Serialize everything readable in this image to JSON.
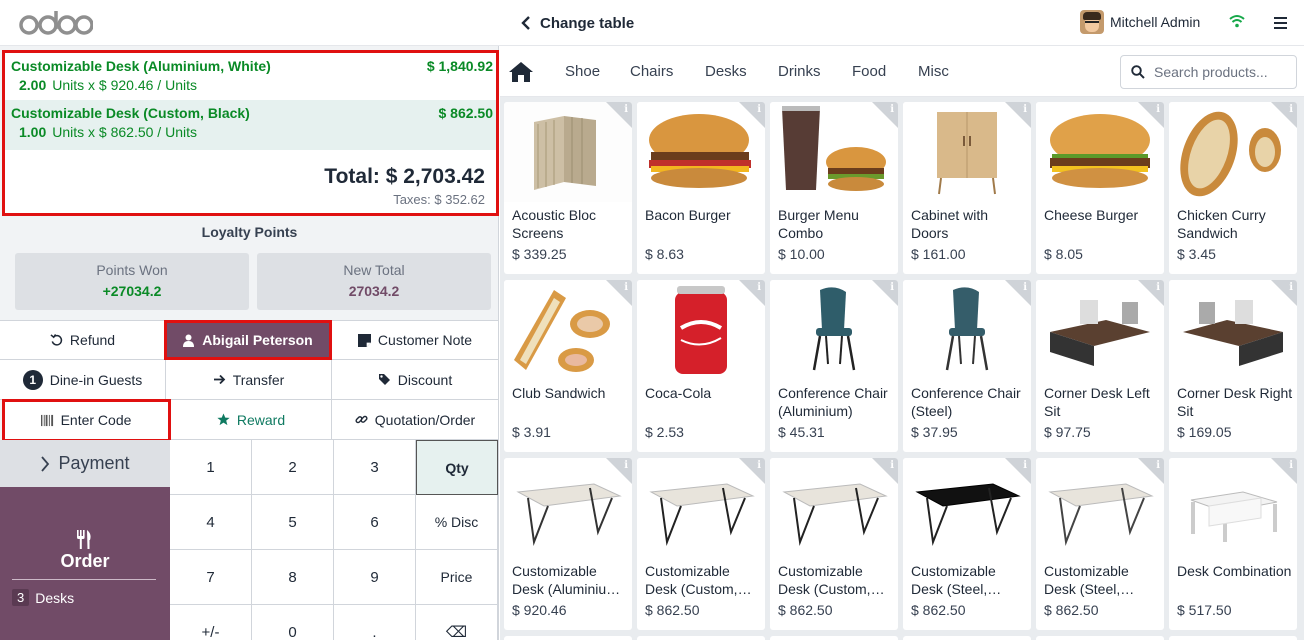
{
  "header": {
    "logo_text": "odoo",
    "back_label": "Change table",
    "user_name": "Mitchell Admin"
  },
  "order": {
    "lines": [
      {
        "name": "Customizable Desk (Aluminium, White)",
        "price": "$ 1,840.92",
        "qty": "2.00",
        "unit_text": "Units x $ 920.46 / Units"
      },
      {
        "name": "Customizable Desk (Custom, Black)",
        "price": "$ 862.50",
        "qty": "1.00",
        "unit_text": "Units x $ 862.50 / Units"
      }
    ],
    "total": "Total: $ 2,703.42",
    "taxes": "Taxes: $ 352.62"
  },
  "loyalty": {
    "title": "Loyalty Points",
    "points_won_label": "Points Won",
    "points_won_value": "+27034.2",
    "new_total_label": "New Total",
    "new_total_value": "27034.2"
  },
  "controls": {
    "refund": "Refund",
    "customer": "Abigail Peterson",
    "customer_note": "Customer Note",
    "guests_count": "1",
    "guests": "Dine-in Guests",
    "transfer": "Transfer",
    "discount": "Discount",
    "enter_code": "Enter Code",
    "reward": "Reward",
    "quotation": "Quotation/Order"
  },
  "payment_label": "Payment",
  "order_button": {
    "label": "Order",
    "count": "3",
    "category": "Desks"
  },
  "keypad": {
    "k1": "1",
    "k2": "2",
    "k3": "3",
    "k4": "4",
    "k5": "5",
    "k6": "6",
    "k7": "7",
    "k8": "8",
    "k9": "9",
    "kpm": "+/-",
    "k0": "0",
    "kdot": ".",
    "qty": "Qty",
    "disc": "% Disc",
    "price": "Price",
    "back": "⌫",
    "active_mode": "Qty"
  },
  "categories": [
    "Shoe",
    "Chairs",
    "Desks",
    "Drinks",
    "Food",
    "Misc"
  ],
  "search": {
    "placeholder": "Search products..."
  },
  "products": [
    {
      "name": "Acoustic Bloc Screens",
      "price": "$ 339.25"
    },
    {
      "name": "Bacon Burger",
      "price": "$ 8.63"
    },
    {
      "name": "Burger Menu Combo",
      "price": "$ 10.00"
    },
    {
      "name": "Cabinet with Doors",
      "price": "$ 161.00"
    },
    {
      "name": "Cheese Burger",
      "price": "$ 8.05"
    },
    {
      "name": "Chicken Curry Sandwich",
      "price": "$ 3.45"
    },
    {
      "name": "Club Sandwich",
      "price": "$ 3.91"
    },
    {
      "name": "Coca-Cola",
      "price": "$ 2.53"
    },
    {
      "name": "Conference Chair (Aluminium)",
      "price": "$ 45.31"
    },
    {
      "name": "Conference Chair (Steel)",
      "price": "$ 37.95"
    },
    {
      "name": "Corner Desk Left Sit",
      "price": "$ 97.75"
    },
    {
      "name": "Corner Desk Right Sit",
      "price": "$ 169.05"
    },
    {
      "name": "Customizable Desk (Aluminiu…",
      "price": "$ 920.46"
    },
    {
      "name": "Customizable Desk (Custom,…",
      "price": "$ 862.50"
    },
    {
      "name": "Customizable Desk (Custom,…",
      "price": "$ 862.50"
    },
    {
      "name": "Customizable Desk (Steel,…",
      "price": "$ 862.50"
    },
    {
      "name": "Customizable Desk (Steel,…",
      "price": "$ 862.50"
    },
    {
      "name": "Desk Combination",
      "price": "$ 517.50"
    }
  ],
  "colors": {
    "brand": "#714b67",
    "accent_green": "#0a8a26",
    "highlight_red": "#e01010"
  }
}
